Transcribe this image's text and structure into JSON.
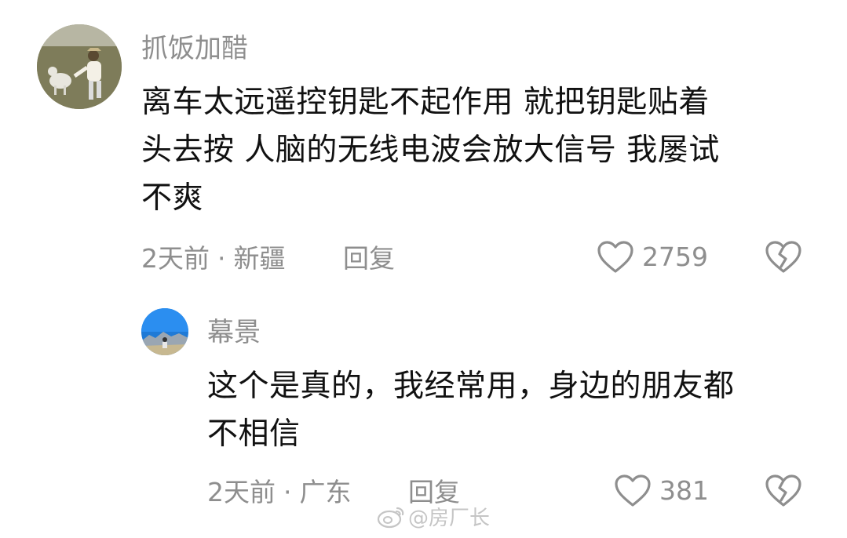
{
  "comments": [
    {
      "username": "抓饭加醋",
      "avatar_icon": "avatar-photo-person-running-with-goat",
      "text_lines": [
        "离车太远遥控钥匙不起作用 就把钥匙贴着",
        "头去按 人脑的无线电波会放大信号 我屡试",
        "不爽"
      ],
      "time": "2天前",
      "separator": "·",
      "location": "新疆",
      "reply_label": "回复",
      "like_count": "2759",
      "like_icon": "heart-outline-icon",
      "dislike_icon": "broken-heart-icon"
    },
    {
      "username": "幕景",
      "avatar_icon": "avatar-photo-blue-sky-mountains",
      "text_lines": [
        "这个是真的，我经常用，身边的朋友都",
        "不相信"
      ],
      "time": "2天前",
      "separator": "·",
      "location": "广东",
      "reply_label": "回复",
      "like_count": "381",
      "like_icon": "heart-outline-icon",
      "dislike_icon": "broken-heart-icon"
    }
  ],
  "watermark": {
    "icon": "weibo-logo-icon",
    "text": "@房厂长"
  },
  "colors": {
    "text_primary": "#111111",
    "text_secondary": "#8e8e8e",
    "background": "#ffffff"
  }
}
